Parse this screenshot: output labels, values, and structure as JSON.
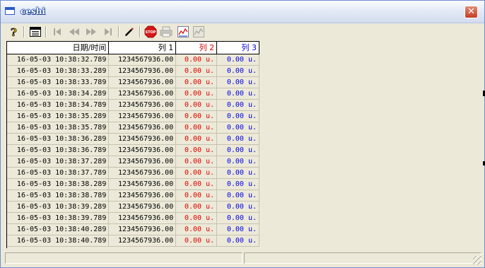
{
  "window": {
    "title": "ceshi",
    "close_glyph": "✕"
  },
  "toolbar": {
    "buttons": [
      {
        "name": "help-icon",
        "enabled": true
      },
      {
        "name": "table-view-icon",
        "enabled": true
      },
      {
        "name": "first-record-icon",
        "enabled": false
      },
      {
        "name": "rewind-icon",
        "enabled": false
      },
      {
        "name": "fast-forward-icon",
        "enabled": false
      },
      {
        "name": "last-record-icon",
        "enabled": false
      },
      {
        "name": "pencil-icon",
        "enabled": true
      },
      {
        "name": "stop-icon",
        "enabled": true
      },
      {
        "name": "print-icon",
        "enabled": false
      },
      {
        "name": "chart-icon",
        "enabled": true
      },
      {
        "name": "chart-disabled-icon",
        "enabled": false
      }
    ],
    "stop_label": "STOP"
  },
  "grid": {
    "columns": [
      "日期/时间",
      "列 1",
      "列 2",
      "列 3"
    ],
    "column_colors": [
      "#000000",
      "#000000",
      "#e00000",
      "#0000e0"
    ],
    "rows": [
      [
        "16-05-03 10:38:32.789",
        "1234567936.00",
        "0.00 u.",
        "0.00 u."
      ],
      [
        "16-05-03 10:38:33.289",
        "1234567936.00",
        "0.00 u.",
        "0.00 u."
      ],
      [
        "16-05-03 10:38:33.789",
        "1234567936.00",
        "0.00 u.",
        "0.00 u."
      ],
      [
        "16-05-03 10:38:34.289",
        "1234567936.00",
        "0.00 u.",
        "0.00 u."
      ],
      [
        "16-05-03 10:38:34.789",
        "1234567936.00",
        "0.00 u.",
        "0.00 u."
      ],
      [
        "16-05-03 10:38:35.289",
        "1234567936.00",
        "0.00 u.",
        "0.00 u."
      ],
      [
        "16-05-03 10:38:35.789",
        "1234567936.00",
        "0.00 u.",
        "0.00 u."
      ],
      [
        "16-05-03 10:38:36.289",
        "1234567936.00",
        "0.00 u.",
        "0.00 u."
      ],
      [
        "16-05-03 10:38:36.789",
        "1234567936.00",
        "0.00 u.",
        "0.00 u."
      ],
      [
        "16-05-03 10:38:37.289",
        "1234567936.00",
        "0.00 u.",
        "0.00 u."
      ],
      [
        "16-05-03 10:38:37.789",
        "1234567936.00",
        "0.00 u.",
        "0.00 u."
      ],
      [
        "16-05-03 10:38:38.289",
        "1234567936.00",
        "0.00 u.",
        "0.00 u."
      ],
      [
        "16-05-03 10:38:38.789",
        "1234567936.00",
        "0.00 u.",
        "0.00 u."
      ],
      [
        "16-05-03 10:38:39.289",
        "1234567936.00",
        "0.00 u.",
        "0.00 u."
      ],
      [
        "16-05-03 10:38:39.789",
        "1234567936.00",
        "0.00 u.",
        "0.00 u."
      ],
      [
        "16-05-03 10:38:40.289",
        "1234567936.00",
        "0.00 u.",
        "0.00 u."
      ],
      [
        "16-05-03 10:38:40.789",
        "1234567936.00",
        "0.00 u.",
        "0.00 u."
      ]
    ]
  },
  "statusbar": {
    "panes": [
      "",
      ""
    ]
  }
}
